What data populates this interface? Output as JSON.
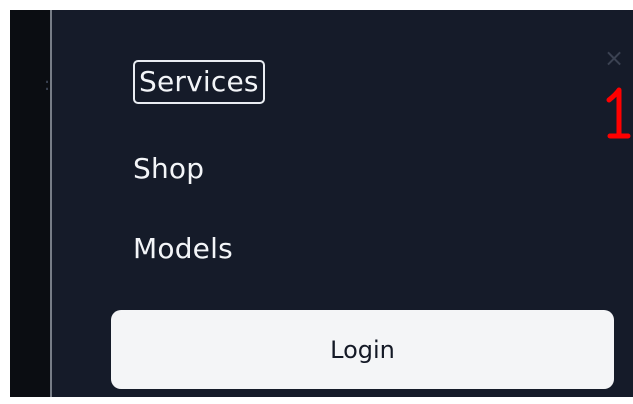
{
  "menu": {
    "items": [
      {
        "label": "Services"
      },
      {
        "label": "Shop"
      },
      {
        "label": "Models"
      }
    ],
    "login_label": "Login"
  },
  "annotation": {
    "text": "1",
    "color": "#ff0000"
  },
  "colors": {
    "panel_bg": "#151b29",
    "menu_text": "#f3f5f8",
    "button_bg": "#f4f5f7"
  },
  "icons": {
    "close": "close-icon"
  }
}
